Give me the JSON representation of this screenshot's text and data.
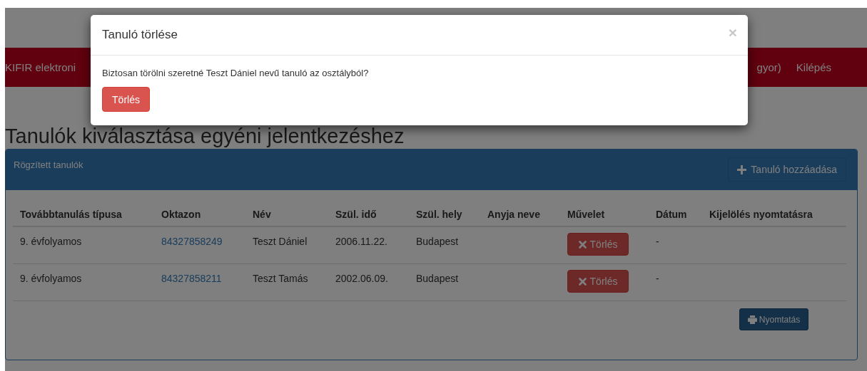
{
  "navbar": {
    "brand": "KIFIR elektroni",
    "items": [
      "gyor)",
      "Kilépés"
    ]
  },
  "page_title": "Tanulók kiválasztása egyéni jelentkezéshez",
  "panel": {
    "title": "Rögzített tanulók",
    "add_button": "Tanuló hozzáadása"
  },
  "table": {
    "columns": [
      "Továbbtanulás típusa",
      "Oktazon",
      "Név",
      "Szül. idő",
      "Szül. hely",
      "Anyja neve",
      "Művelet",
      "Dátum",
      "Kijelölés nyomtatásra"
    ],
    "rows": [
      {
        "type": "9. évfolyamos",
        "oktazon": "84327858249",
        "name": "Teszt Dániel",
        "birth_date": "2006.11.22.",
        "birth_place": "Budapest",
        "action": "Törlés",
        "date": "-"
      },
      {
        "type": "9. évfolyamos",
        "oktazon": "84327858211",
        "name": "Teszt Tamás",
        "birth_date": "2002.06.09.",
        "birth_place": "Budapest",
        "action": "Törlés",
        "date": "-"
      }
    ]
  },
  "print_button": "Nyomtatás",
  "modal": {
    "title": "Tanuló törlése",
    "close": "×",
    "message": "Biztosan törölni szeretné Teszt Dániel nevű tanuló az osztályból?",
    "button": "Törlés"
  }
}
